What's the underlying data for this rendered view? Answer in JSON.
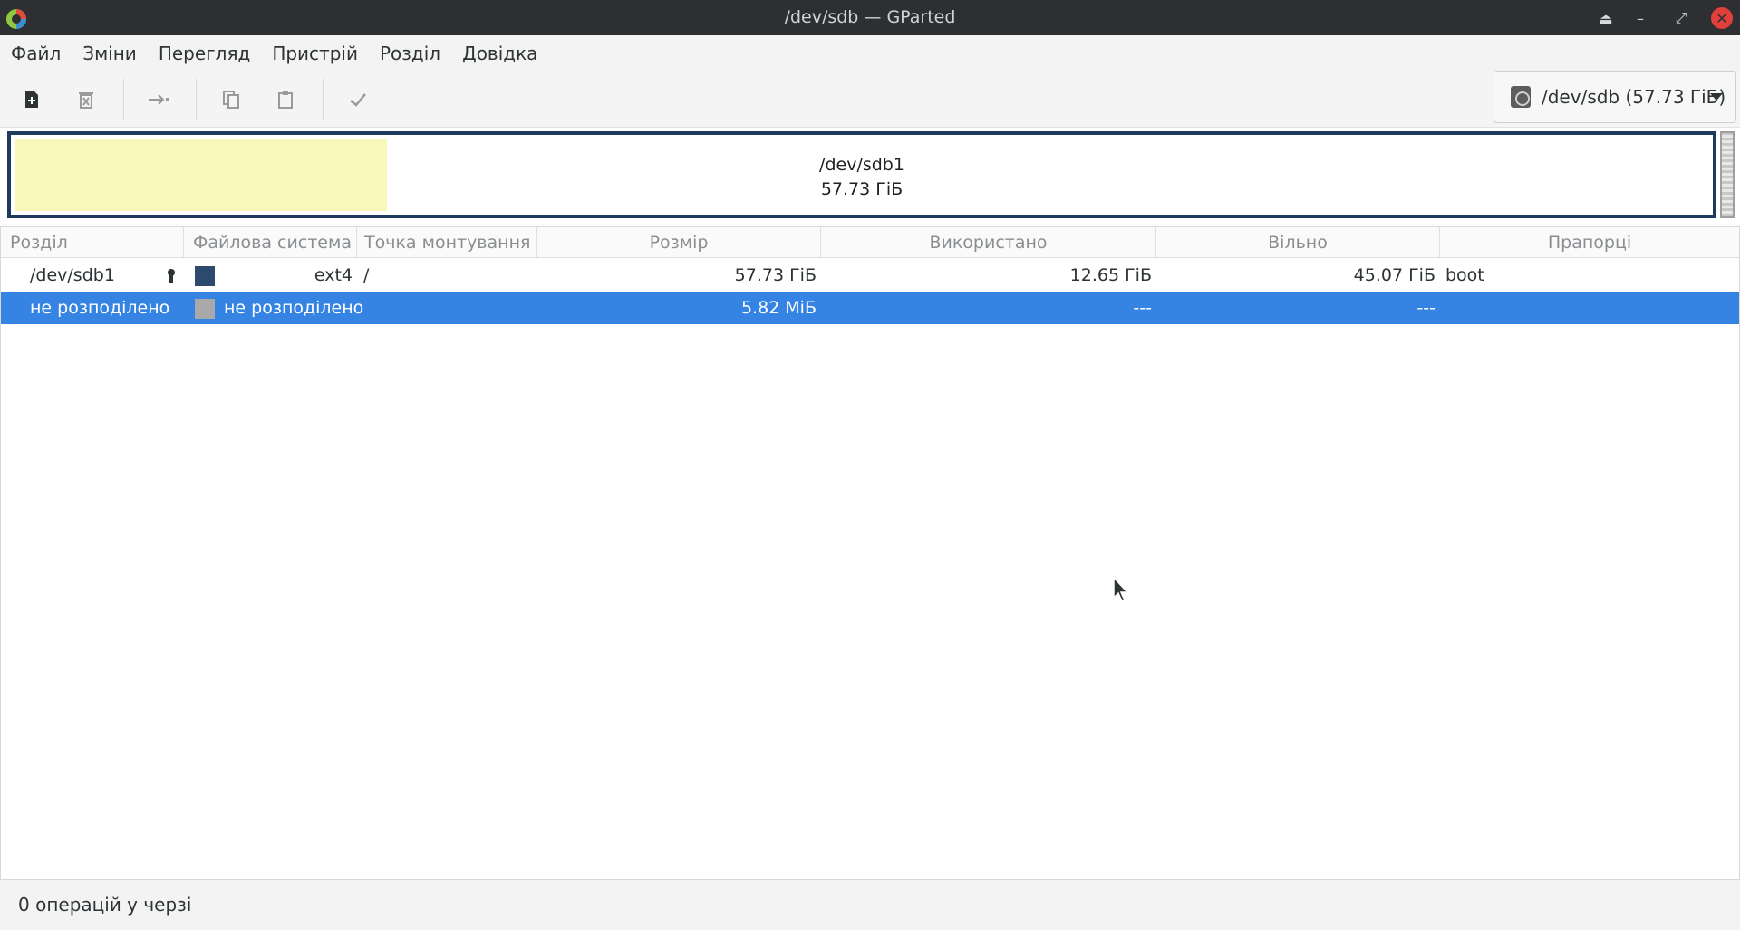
{
  "window": {
    "title": "/dev/sdb — GParted"
  },
  "menu": [
    "Файл",
    "Зміни",
    "Перегляд",
    "Пристрій",
    "Розділ",
    "Довідка"
  ],
  "toolbar": {
    "buttons": [
      "new-partition-icon",
      "delete-icon",
      "resize-move-icon",
      "copy-icon",
      "paste-icon",
      "apply-icon"
    ],
    "device": "/dev/sdb (57.73 ГіБ)"
  },
  "diskmap": {
    "partition": "/dev/sdb1",
    "size": "57.73 ГіБ",
    "used_fraction": 0.22
  },
  "table": {
    "headers": [
      "Розділ",
      "Файлова система",
      "Точка монтування",
      "Розмір",
      "Використано",
      "Вільно",
      "Прапорці"
    ],
    "rows": [
      {
        "partition": "/dev/sdb1",
        "fs": "ext4",
        "mount": "/",
        "size": "57.73 ГіБ",
        "used": "12.65 ГіБ",
        "free": "45.07 ГіБ",
        "flags": "boot",
        "fs_color": "#2b4a6e"
      },
      {
        "partition": "не розподілено",
        "fs": "не розподілено",
        "mount": "",
        "size": "5.82 МіБ",
        "used": "---",
        "free": "---",
        "flags": "",
        "fs_color": "#a9a9a9"
      }
    ]
  },
  "status": "0 операцій у черзі",
  "colors": {
    "selection": "#3584e4",
    "used_space": "#f8f8b8",
    "disk_border": "#1e3a5c"
  }
}
